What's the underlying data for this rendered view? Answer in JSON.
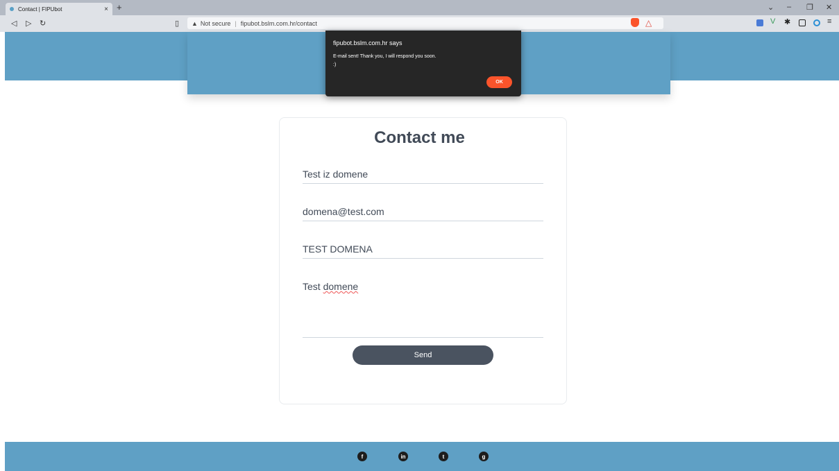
{
  "browser": {
    "tab_title": "Contact | FIPUbot",
    "tab_close": "×",
    "new_tab": "+",
    "security_label": "Not secure",
    "url": "fipubot.bslm.com.hr/contact"
  },
  "contact": {
    "title": "Contact me",
    "name_value": "Test iz domene",
    "email_value": "domena@test.com",
    "subject_value": "TEST DOMENA",
    "message_word1": "Test",
    "message_word2": "domene",
    "send_label": "Send"
  },
  "dialog": {
    "site_says": "fipubot.bslm.com.hr says",
    "message_line1": "E-mail sent! Thank you, I will respond you soon.",
    "message_line2": ":)",
    "ok_label": "OK"
  },
  "footer": {
    "facebook": "f",
    "linkedin": "in",
    "twitter": "t",
    "github": "g"
  },
  "colors": {
    "brand_blue": "#5fa0c5",
    "button_dark": "#4a5360",
    "ok_orange": "#fb542b"
  },
  "icons": [
    "back-icon",
    "forward-icon",
    "reload-icon",
    "bookmark-icon",
    "warning-icon",
    "brave-shield-icon",
    "brave-rewards-icon",
    "extension-icon",
    "facebook-icon",
    "linkedin-icon",
    "twitter-icon",
    "github-icon"
  ]
}
